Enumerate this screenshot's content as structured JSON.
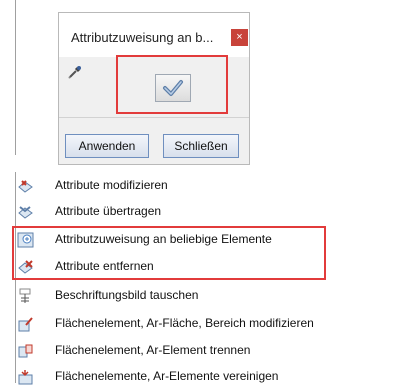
{
  "dialog": {
    "title": "Attributzuweisung an b...",
    "close_glyph": "×",
    "apply_label": "Anwenden",
    "close_label": "Schließen",
    "picker_icon": "eyedropper-icon",
    "action_icon": "checkmark-icon"
  },
  "menu": {
    "items": [
      {
        "label": "Attribute modifizieren",
        "icon": "attribute-modify-icon"
      },
      {
        "label": "Attribute übertragen",
        "icon": "attribute-transfer-icon"
      },
      {
        "label": "Attributzuweisung an beliebige Elemente",
        "icon": "attribute-assign-icon"
      },
      {
        "label": "Attribute entfernen",
        "icon": "attribute-remove-icon"
      },
      {
        "label": "Beschriftungsbild tauschen",
        "icon": "label-swap-icon"
      },
      {
        "label": "Flächenelement, Ar-Fläche, Bereich modifizieren",
        "icon": "area-modify-icon"
      },
      {
        "label": "Flächenelement, Ar-Element trennen",
        "icon": "area-split-icon"
      },
      {
        "label": "Flächenelemente, Ar-Elemente vereinigen",
        "icon": "area-merge-icon"
      }
    ]
  },
  "colors": {
    "highlight": "#e23b3b",
    "close": "#c8433a",
    "check": "#4a7fc1"
  }
}
